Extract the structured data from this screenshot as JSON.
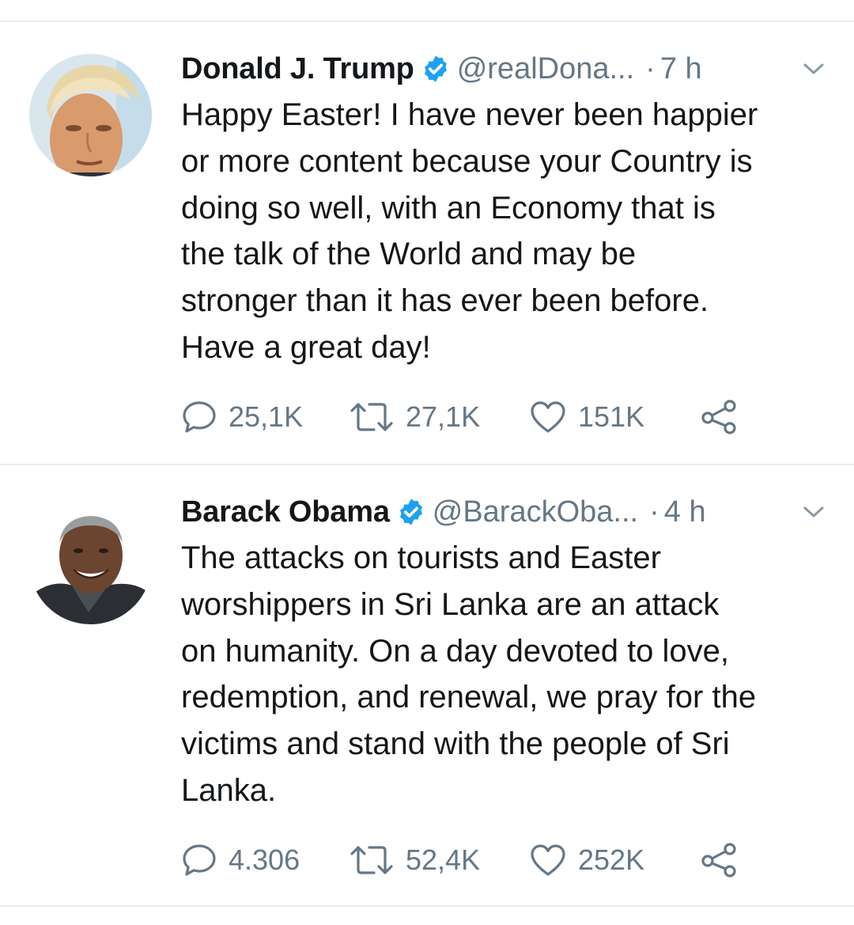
{
  "tweets": [
    {
      "name": "Donald J. Trump",
      "handle": "@realDona...",
      "dot": "·",
      "time": "7 h",
      "lines": [
        "Happy Easter! I have never been happier",
        "or more content because your Country is",
        "doing so well, with an Economy that is",
        "the talk of the World and may be",
        "stronger than it has ever been before.",
        "Have a great day!"
      ],
      "replies": "25,1K",
      "retweets": "27,1K",
      "likes": "151K"
    },
    {
      "name": "Barack Obama",
      "handle": "@BarackOba...",
      "dot": "·",
      "time": "4 h",
      "lines": [
        "The attacks on tourists and Easter",
        "worshippers in Sri Lanka are an attack",
        "on humanity. On a day devoted to love,",
        "redemption, and renewal, we pray for the",
        "victims and stand with the people of Sri",
        "Lanka."
      ],
      "replies": "4.306",
      "retweets": "52,4K",
      "likes": "252K"
    }
  ],
  "colors": {
    "verified": "#1da1f2",
    "secondary_text": "#657786",
    "divider": "#e6ecf0"
  },
  "icons": [
    "verified-badge-icon",
    "chevron-down-icon",
    "reply-icon",
    "retweet-icon",
    "like-icon",
    "share-icon"
  ]
}
